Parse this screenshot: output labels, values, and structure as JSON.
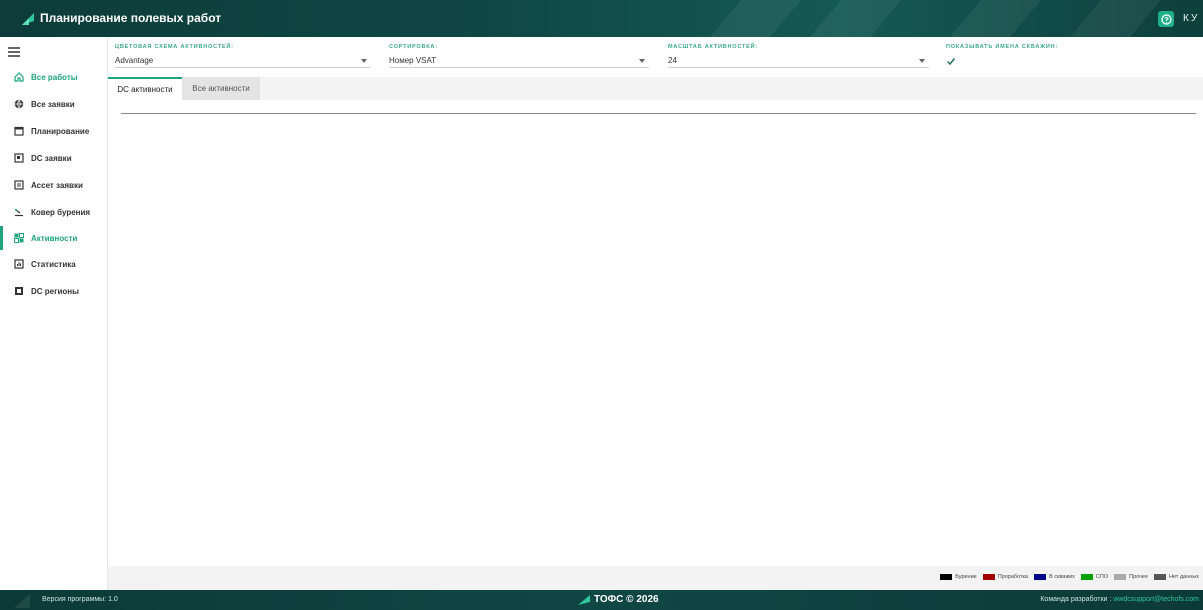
{
  "header": {
    "title": "Планирование полевых работ",
    "user": "КУ",
    "help_icon": "help-circle-icon"
  },
  "sidebar": {
    "items": [
      {
        "label": "Все работы",
        "icon": "home-icon",
        "state": "highlight"
      },
      {
        "label": "Все заявки",
        "icon": "globe-icon"
      },
      {
        "label": "Планирование",
        "icon": "calendar-icon"
      },
      {
        "label": "DC заявки",
        "icon": "dc-card-icon"
      },
      {
        "label": "Ассет заявки",
        "icon": "asset-card-icon"
      },
      {
        "label": "Ковер бурения",
        "icon": "drill-icon"
      },
      {
        "label": "Активности",
        "icon": "grid-icon",
        "state": "selected"
      },
      {
        "label": "Статистика",
        "icon": "bar-chart-icon"
      },
      {
        "label": "DC регионы",
        "icon": "region-icon"
      }
    ]
  },
  "filters": {
    "color_scheme": {
      "label": "ЦВЕТОВАЯ СХЕМА АКТИВНОСТЕЙ:",
      "value": "Advantage"
    },
    "sort": {
      "label": "СОРТИРОВКА:",
      "value": "Номер VSAT"
    },
    "scale": {
      "label": "МАСШТАБ АКТИВНОСТЕЙ:",
      "value": "24"
    },
    "show_names": {
      "label": "ПОКАЗЫВАТЬ ИМЕНА СКВАЖИН:",
      "checked": true
    }
  },
  "tabs": [
    {
      "label": "DC активности",
      "active": true
    },
    {
      "label": "Все активности",
      "active": false
    }
  ],
  "legend": [
    {
      "label": "Бурение",
      "color": "#000000"
    },
    {
      "label": "Проработка",
      "color": "#a30000"
    },
    {
      "label": "В скважих",
      "color": "#00008b"
    },
    {
      "label": "СПО",
      "color": "#00a000"
    },
    {
      "label": "Прочее",
      "color": "#aaaaaa"
    },
    {
      "label": "Нет данных",
      "color": "#555555"
    }
  ],
  "footer": {
    "version": "Версия программы: 1.0",
    "copyright": "ТОФС © 2026",
    "team_label": "Команда разработки :",
    "team_email": "wwdcsupport@techofs.com"
  },
  "colors": {
    "accent": "#1fa37f",
    "header_bg": "#0f4744"
  }
}
